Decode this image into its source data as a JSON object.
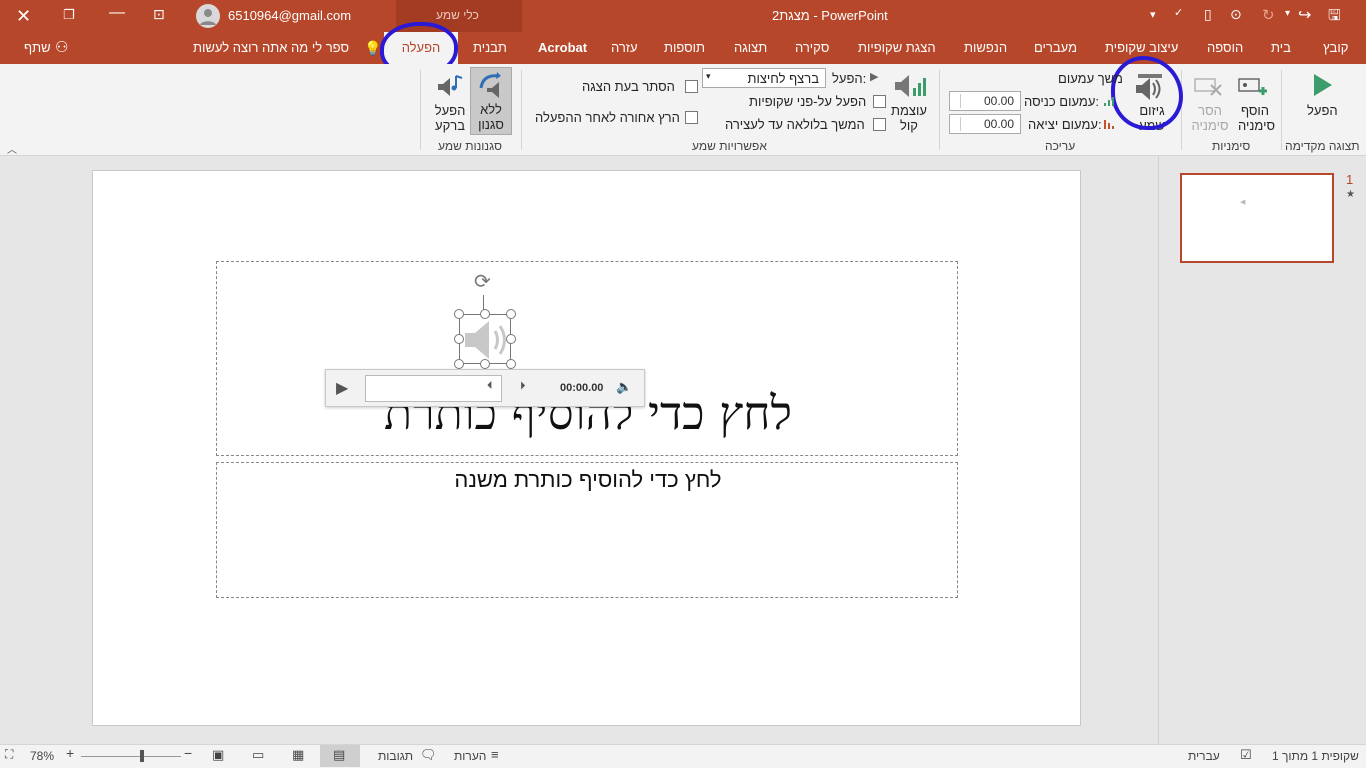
{
  "titlebar": {
    "doc_title": "מצגת2  -  PowerPoint",
    "account_email": "6510964@gmail.com",
    "contextual_group": "כלי שמע"
  },
  "tabs": {
    "file": "קובץ",
    "home": "בית",
    "insert": "הוספה",
    "design": "עיצוב שקופית",
    "transitions": "מעברים",
    "animations": "הנפשות",
    "slideshow": "הצגת שקופיות",
    "review": "סקירה",
    "view": "תצוגה",
    "addins": "תוספות",
    "help": "עזרה",
    "acrobat": "Acrobat",
    "format": "תבנית",
    "playback": "הפעלה",
    "tell_me": "ספר לי מה אתה רוצה לעשות",
    "share": "שתף"
  },
  "ribbon": {
    "preview": {
      "play_label": "הפעל",
      "group": "תצוגה מקדימה"
    },
    "bookmarks": {
      "add_label": "הוסף סימניה",
      "remove_label": "הסר סימניה",
      "group": "סימניות"
    },
    "editing": {
      "trim_label": "גיזום שמע",
      "fade_duration": "משך עמעום",
      "fade_in_label": "עמעום כניסה:",
      "fade_in_value": "00.00",
      "fade_out_label": "עמעום יציאה:",
      "fade_out_value": "00.00",
      "group": "עריכה"
    },
    "audio_options": {
      "volume_label": "עוצמת קול",
      "start_label": "הפעל:",
      "start_value": "ברצף לחיצות",
      "across_slides": "הפעל על-פני שקופיות",
      "loop_until_stopped": "המשך בלולאה עד לעצירה",
      "hide_during_show": "הסתר בעת הצגה",
      "rewind_after": "הרץ אחורה לאחר ההפעלה",
      "group": "אפשרויות שמע"
    },
    "audio_styles": {
      "no_style": "ללא סגנון",
      "play_in_bg": "הפעל ברקע",
      "group": "סגנונות שמע"
    }
  },
  "slide": {
    "title_placeholder": "לחץ כדי להוסיף כותרת",
    "subtitle_placeholder": "לחץ כדי להוסיף כותרת משנה",
    "player_time": "00:00.00"
  },
  "thumbnails": {
    "slide_number": "1",
    "star": "★"
  },
  "statusbar": {
    "slide_count": "שקופית 1 מתוך 1",
    "language": "עברית",
    "notes": "הערות",
    "comments": "תגובות",
    "zoom": "78%"
  },
  "colors": {
    "accent": "#b7472a",
    "ink": "#2a1ad6",
    "ribbon_bg": "#f3f3f3"
  }
}
